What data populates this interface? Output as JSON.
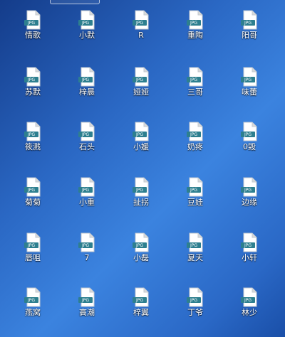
{
  "desktop": {
    "file_type_badge": "JPG",
    "icons": [
      {
        "name": "情歌"
      },
      {
        "name": "小默"
      },
      {
        "name": "R"
      },
      {
        "name": "重陶"
      },
      {
        "name": "阳哥"
      },
      {
        "name": "苏默"
      },
      {
        "name": "梓晨"
      },
      {
        "name": "娅娅"
      },
      {
        "name": "三哥"
      },
      {
        "name": "味蕾"
      },
      {
        "name": "筱溅"
      },
      {
        "name": "石头"
      },
      {
        "name": "小媛"
      },
      {
        "name": "奶疼"
      },
      {
        "name": "0毁"
      },
      {
        "name": "菊菊"
      },
      {
        "name": "小重"
      },
      {
        "name": "扯拐"
      },
      {
        "name": "豆娃"
      },
      {
        "name": "边缘"
      },
      {
        "name": "唇咀"
      },
      {
        "name": "7"
      },
      {
        "name": "小磊"
      },
      {
        "name": "夏天"
      },
      {
        "name": "小轩"
      },
      {
        "name": "燕窝"
      },
      {
        "name": "高潮"
      },
      {
        "name": "梓翼"
      },
      {
        "name": "丁爷"
      },
      {
        "name": "林少"
      }
    ]
  },
  "colors": {
    "badge_background": "#2d7f8f",
    "page_fill": "#ffffff",
    "page_fold": "#d9d9d9"
  }
}
